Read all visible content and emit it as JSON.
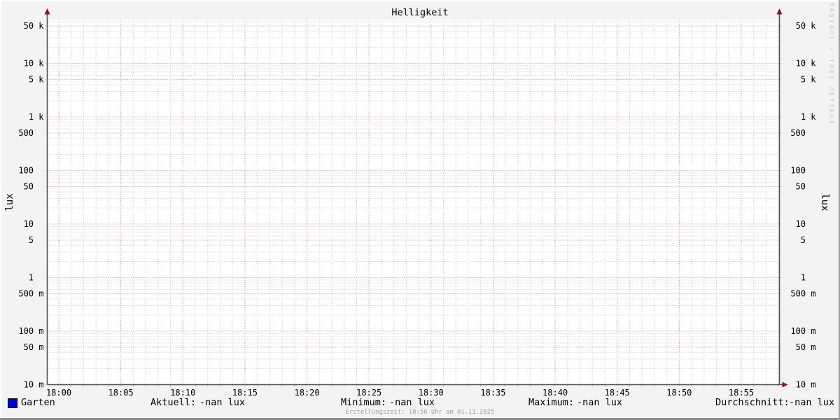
{
  "header": {
    "title": "Helligkeit"
  },
  "axis": {
    "left_unit": "lux",
    "right_unit": "lux"
  },
  "watermark": "RRDTOOL / TOBI OETIKER",
  "legend": {
    "items": [
      {
        "label": "Garten",
        "color": "#0000cc"
      }
    ]
  },
  "stats": [
    {
      "label": "Aktuell:",
      "value": "-nan lux"
    },
    {
      "label": "Minimum:",
      "value": "-nan lux"
    },
    {
      "label": "Maximum:",
      "value": "-nan lux"
    },
    {
      "label": "Durchschnitt:",
      "value": "-nan lux"
    }
  ],
  "footer": {
    "creation": "Erstellungszeit: 18:50 Uhr am 01.11.2025"
  },
  "colors": {
    "background": "#f3f3f3",
    "canvas": "#ffffff",
    "axis": "#4f4f4f",
    "arrow": "#8b1616",
    "grid_minor": "#c9c9c9",
    "grid_major": "#ec8282",
    "tick_text": "#000000",
    "watermark": "#c6c6c6",
    "footer_text": "#9e9e9e"
  },
  "chart_data": {
    "type": "line",
    "title": "Helligkeit",
    "xlabel": "",
    "ylabel": "lux",
    "y_scale": "log10",
    "ylim": [
      0.01,
      62000
    ],
    "grid": true,
    "legend_position": "bottom-left",
    "y_ticks": [
      {
        "value": 50000,
        "label": "50 k"
      },
      {
        "value": 10000,
        "label": "10 k"
      },
      {
        "value": 5000,
        "label": "5 k"
      },
      {
        "value": 1000,
        "label": "1 k"
      },
      {
        "value": 500,
        "label": "500"
      },
      {
        "value": 100,
        "label": "100"
      },
      {
        "value": 50,
        "label": "50"
      },
      {
        "value": 10,
        "label": "10"
      },
      {
        "value": 5,
        "label": "5"
      },
      {
        "value": 1,
        "label": "1"
      },
      {
        "value": 0.5,
        "label": "500 m"
      },
      {
        "value": 0.1,
        "label": "100 m"
      },
      {
        "value": 0.05,
        "label": "50 m"
      },
      {
        "value": 0.01,
        "label": "10 m"
      }
    ],
    "x_ticks": [
      "18:00",
      "18:05",
      "18:10",
      "18:15",
      "18:20",
      "18:25",
      "18:30",
      "18:35",
      "18:40",
      "18:45",
      "18:50",
      "18:55"
    ],
    "x_minor_step_minutes": 1,
    "x_major_step_minutes": 5,
    "x_range_minutes": 58,
    "series": [
      {
        "name": "Garten",
        "color": "#0000cc",
        "values": [],
        "note": "no data plotted (all values -nan)"
      }
    ]
  }
}
